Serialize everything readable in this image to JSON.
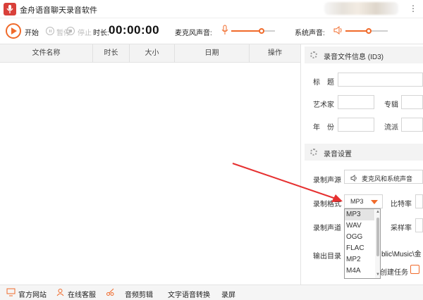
{
  "app": {
    "title": "金舟语音聊天录音软件"
  },
  "controls": {
    "start_label": "开始",
    "pause_label": "暂停",
    "stop_label": "停止",
    "duration_label": "时长:",
    "duration_value": "00:00:00",
    "mic_label": "麦克风声音:",
    "mic_level": 0.7,
    "system_label": "系统声音:",
    "system_level": 0.55
  },
  "file_list": {
    "columns": [
      "文件名称",
      "时长",
      "大小",
      "日期",
      "操作"
    ],
    "rows": []
  },
  "id3": {
    "section_title": "录音文件信息 (ID3)",
    "title_label": "标　题",
    "artist_label": "艺术家",
    "album_label": "专辑",
    "year_label": "年　份",
    "genre_label": "流派"
  },
  "settings": {
    "section_title": "录音设置",
    "source_label": "录制声源",
    "source_value": "麦克风和系统声音",
    "format_label": "录制格式",
    "format_value": "MP3",
    "format_options": [
      "MP3",
      "WAV",
      "OGG",
      "FLAC",
      "MP2",
      "M4A"
    ],
    "bitrate_label": "比特率",
    "channel_label": "录制声道",
    "samplerate_label": "采样率",
    "output_label": "输出目录",
    "output_path": "blic\\Music\\金",
    "create_task_label": "创建任务"
  },
  "bottom": {
    "website": "官方网站",
    "support": "在线客服",
    "audio_edit": "音频剪辑",
    "tts": "文字语音转换",
    "screen_record": "录屏"
  },
  "colors": {
    "accent": "#f06a2a",
    "arrow": "#e63030",
    "logo": "#d9403a"
  }
}
